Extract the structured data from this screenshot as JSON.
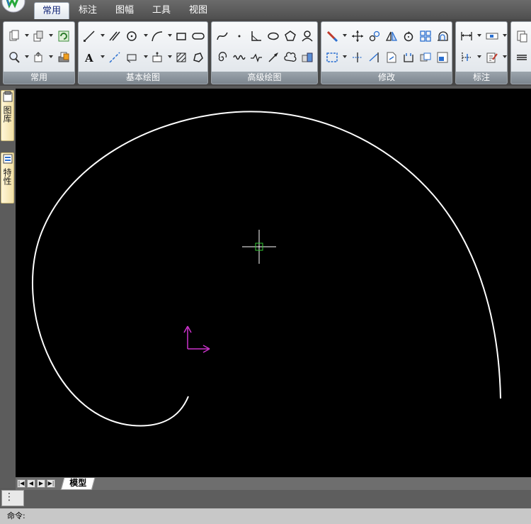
{
  "menu": {
    "tabs": [
      {
        "label": "常用"
      },
      {
        "label": "标注"
      },
      {
        "label": "图幅"
      },
      {
        "label": "工具"
      },
      {
        "label": "视图"
      }
    ],
    "active_index": 0
  },
  "ribbon": {
    "groups": [
      {
        "label": "常用"
      },
      {
        "label": "基本绘图"
      },
      {
        "label": "高级绘图"
      },
      {
        "label": "修改"
      },
      {
        "label": "标注"
      }
    ]
  },
  "side_panel": {
    "tabs": [
      {
        "label": "图库"
      },
      {
        "label": "特性"
      }
    ]
  },
  "layout_tabs": {
    "model_label": "模型",
    "nav": [
      "first",
      "prev",
      "next",
      "last"
    ]
  },
  "command": {
    "prompt": "命令:"
  },
  "colors": {
    "canvas_background": "#000000",
    "curve": "#ffffff",
    "crosshair": "#ffffff",
    "ucs_icon": "#cc33cc",
    "pickbox": "#33cc33"
  }
}
